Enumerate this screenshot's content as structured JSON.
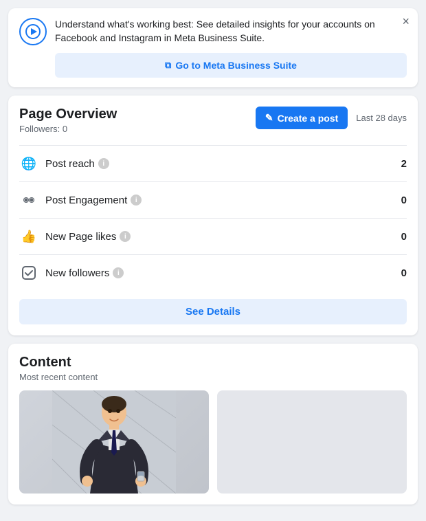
{
  "banner": {
    "icon": "▷",
    "text": "Understand what's working best: See detailed insights for your accounts on Facebook and Instagram in Meta Business Suite.",
    "cta_label": "Go to Meta Business Suite",
    "cta_icon": "⧉",
    "close_label": "×"
  },
  "page_overview": {
    "title": "Page Overview",
    "subtitle": "Followers: 0",
    "create_post_label": "Create a post",
    "create_post_icon": "✎",
    "date_range": "Last 28 days",
    "metrics": [
      {
        "id": "post-reach",
        "icon": "🌐",
        "label": "Post reach",
        "value": "2"
      },
      {
        "id": "post-engagement",
        "icon": "👥",
        "label": "Post Engagement",
        "value": "0"
      },
      {
        "id": "new-page-likes",
        "icon": "👍",
        "label": "New Page likes",
        "value": "0"
      },
      {
        "id": "new-followers",
        "icon": "✅",
        "label": "New followers",
        "value": "0"
      }
    ],
    "see_details_label": "See Details"
  },
  "content": {
    "title": "Content",
    "subtitle": "Most recent content"
  },
  "colors": {
    "accent": "#1877f2",
    "accent_bg": "#e7f0fd",
    "text_primary": "#1c1e21",
    "text_secondary": "#606770"
  }
}
